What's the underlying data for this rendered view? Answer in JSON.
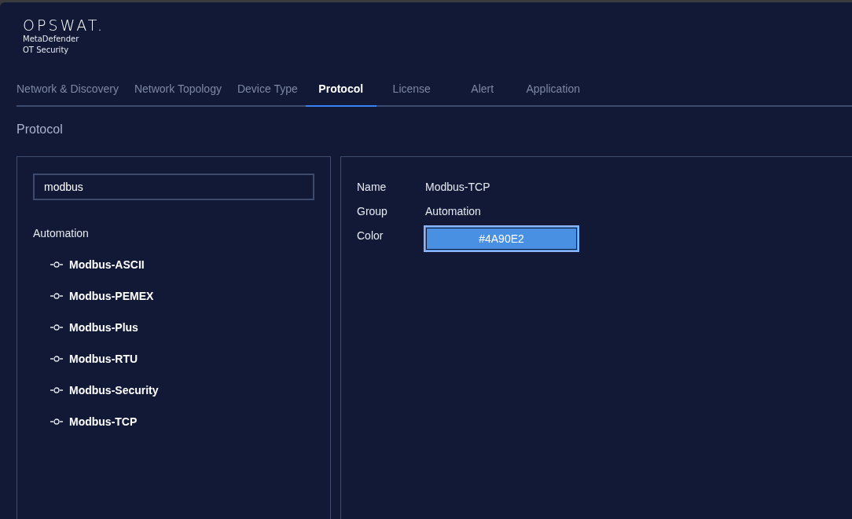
{
  "logo": {
    "brand": "OPSWAT.",
    "product_line_1": "MetaDefender",
    "product_line_2": "OT Security"
  },
  "tabs": [
    {
      "label": "Network & Discovery",
      "selected": false
    },
    {
      "label": "Network Topology",
      "selected": false
    },
    {
      "label": "Device Type",
      "selected": false
    },
    {
      "label": "Protocol",
      "selected": true
    },
    {
      "label": "License",
      "selected": false
    },
    {
      "label": "Alert",
      "selected": false
    },
    {
      "label": "Application",
      "selected": false
    }
  ],
  "page_title": "Protocol",
  "search": {
    "value": "modbus"
  },
  "tree": [
    {
      "label": "Automation",
      "children": [
        {
          "label": "Modbus-ASCII"
        },
        {
          "label": "Modbus-PEMEX"
        },
        {
          "label": "Modbus-Plus"
        },
        {
          "label": "Modbus-RTU"
        },
        {
          "label": "Modbus-Security"
        },
        {
          "label": "Modbus-TCP"
        }
      ]
    }
  ],
  "details": {
    "name_label": "Name",
    "name_value": "Modbus-TCP",
    "group_label": "Group",
    "group_value": "Automation",
    "color_label": "Color",
    "color_value": "#4A90E2"
  }
}
